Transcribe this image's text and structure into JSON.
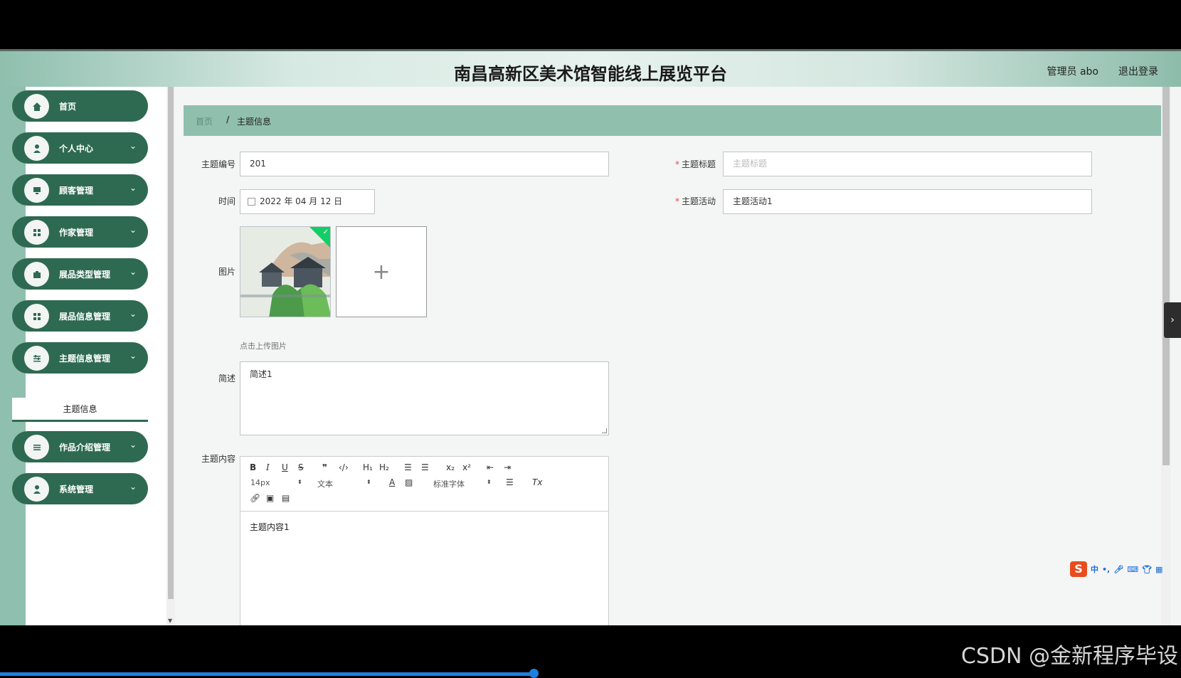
{
  "header": {
    "title": "南昌高新区美术馆智能线上展览平台",
    "admin": "管理员 abo",
    "logout": "退出登录"
  },
  "sidebar": {
    "items": [
      {
        "label": "首页",
        "icon": "home-icon",
        "chevron": ""
      },
      {
        "label": "个人中心",
        "icon": "user-icon",
        "chevron": "⌄"
      },
      {
        "label": "顾客管理",
        "icon": "monitor-icon",
        "chevron": "⌄"
      },
      {
        "label": "作家管理",
        "icon": "grid-icon",
        "chevron": "⌄"
      },
      {
        "label": "展品类型管理",
        "icon": "briefcase-icon",
        "chevron": "⌄"
      },
      {
        "label": "展品信息管理",
        "icon": "grid-icon",
        "chevron": "⌄"
      },
      {
        "label": "主题信息管理",
        "icon": "sliders-icon",
        "chevron": "⌄"
      },
      {
        "label": "作品介绍管理",
        "icon": "list-icon",
        "chevron": "⌄"
      },
      {
        "label": "系统管理",
        "icon": "user-icon",
        "chevron": "⌄"
      }
    ],
    "sub_item": "主题信息"
  },
  "breadcrumb": {
    "home": "首页",
    "separator": "/",
    "current": "主题信息"
  },
  "form": {
    "theme_no_label": "主题编号",
    "theme_no_value": "201",
    "theme_title_label": "主题标题",
    "theme_title_placeholder": "主题标题",
    "time_label": "时间",
    "time_value": "2022 年 04 月 12 日",
    "theme_activity_label": "主题活动",
    "theme_activity_value": "主题活动1",
    "image_label": "图片",
    "upload_tip": "点击上传图片",
    "summary_label": "简述",
    "summary_value": "简述1",
    "content_label": "主题内容",
    "content_value": "主题内容1",
    "required_mark": "*"
  },
  "editor_toolbar": {
    "font_size": "14px",
    "block_type": "文本",
    "font_family": "标准字体"
  },
  "ime": {
    "logo": "S",
    "mode": "中"
  },
  "watermark": "CSDN @金新程序毕设",
  "colors": {
    "sidebar_green": "#2e6a52",
    "header_green": "#8fbfae",
    "breadcrumb_green": "#90bfae"
  }
}
